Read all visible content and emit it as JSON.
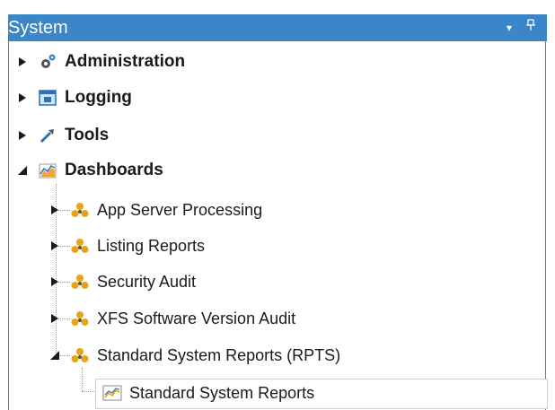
{
  "panel": {
    "title": "System",
    "dropdown_glyph": "▾",
    "pin_glyph": "ᵠ"
  },
  "tree": {
    "top": [
      {
        "label": "Administration",
        "icon": "gears-icon",
        "expanded": false
      },
      {
        "label": "Logging",
        "icon": "log-window-icon",
        "expanded": false
      },
      {
        "label": "Tools",
        "icon": "tools-icon",
        "expanded": false
      },
      {
        "label": "Dashboards",
        "icon": "dashboard-chart-icon",
        "expanded": true
      }
    ],
    "dashboards": [
      {
        "label": "App Server Processing",
        "icon": "dashboard-group-icon",
        "expanded": false
      },
      {
        "label": "Listing Reports",
        "icon": "dashboard-group-icon",
        "expanded": false
      },
      {
        "label": "Security Audit",
        "icon": "dashboard-group-icon",
        "expanded": false
      },
      {
        "label": "XFS Software Version Audit",
        "icon": "dashboard-group-icon",
        "expanded": false
      },
      {
        "label": "Standard System Reports (RPTS)",
        "icon": "dashboard-group-icon",
        "expanded": true
      }
    ],
    "reports": [
      {
        "label": "Standard System Reports",
        "icon": "report-chart-icon",
        "selected": true
      }
    ]
  },
  "colors": {
    "title_bar": "#3a86c8",
    "group_icon": "#e8a317",
    "text": "#1a1a1a"
  }
}
